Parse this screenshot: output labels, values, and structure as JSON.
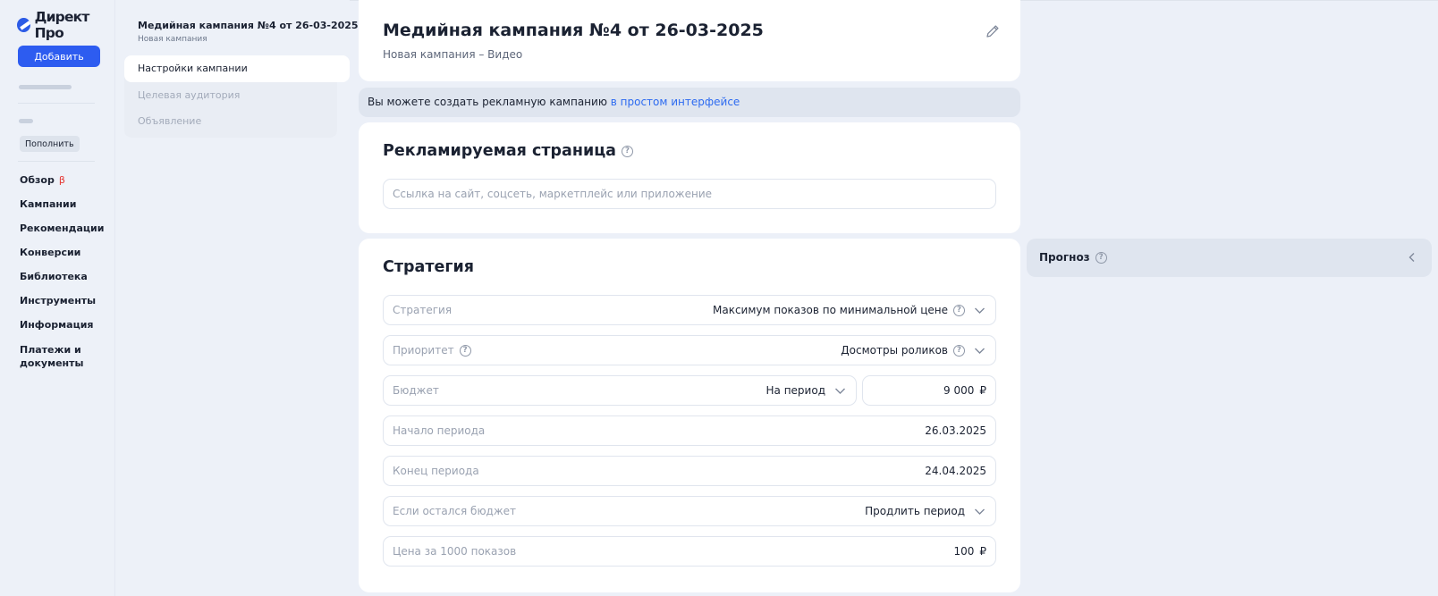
{
  "brand": {
    "name": "Директ Про"
  },
  "left_nav": {
    "add_label": "Добавить",
    "topup_label": "Пополнить",
    "items": [
      {
        "label": "Обзор",
        "badge": "β"
      },
      {
        "label": "Кампании"
      },
      {
        "label": "Рекомендации"
      },
      {
        "label": "Конверсии"
      },
      {
        "label": "Библиотека"
      },
      {
        "label": "Инструменты"
      },
      {
        "label": "Информация"
      },
      {
        "label": "Платежи и документы"
      }
    ]
  },
  "campaign_nav": {
    "title": "Медийная кампания №4 от 26-03-2025",
    "subtitle": "Новая кампания",
    "steps": [
      {
        "label": "Настройки кампании",
        "active": true
      },
      {
        "label": "Целевая аудитория",
        "active": false
      },
      {
        "label": "Объявление",
        "active": false
      }
    ]
  },
  "header": {
    "title": "Медийная кампания №4 от 26-03-2025",
    "subtitle": "Новая кампания – Видео"
  },
  "banner": {
    "text": "Вы можете создать рекламную кампанию",
    "link_text": "в простом интерфейсе"
  },
  "advertised_page": {
    "title": "Рекламируемая страница",
    "placeholder": "Ссылка на сайт, соцсеть, маркетплейс или приложение",
    "value": ""
  },
  "strategy": {
    "title": "Стратегия",
    "fields": {
      "strategy": {
        "label": "Стратегия",
        "value": "Максимум показов по минимальной цене"
      },
      "priority": {
        "label": "Приоритет",
        "value": "Досмотры роликов"
      },
      "budget": {
        "label": "Бюджет",
        "period": "На период",
        "amount": "9 000",
        "currency": "₽"
      },
      "start": {
        "label": "Начало периода",
        "value": "26.03.2025"
      },
      "end": {
        "label": "Конец периода",
        "value": "24.04.2025"
      },
      "leftover": {
        "label": "Если остался бюджет",
        "value": "Продлить период"
      },
      "cpm": {
        "label": "Цена за 1000 показов",
        "amount": "100",
        "currency": "₽"
      }
    }
  },
  "forecast": {
    "title": "Прогноз"
  },
  "colors": {
    "accent": "#2d5cf0",
    "link": "#2d6bf0",
    "beta": "#e63531",
    "background": "#ecf0f8"
  }
}
